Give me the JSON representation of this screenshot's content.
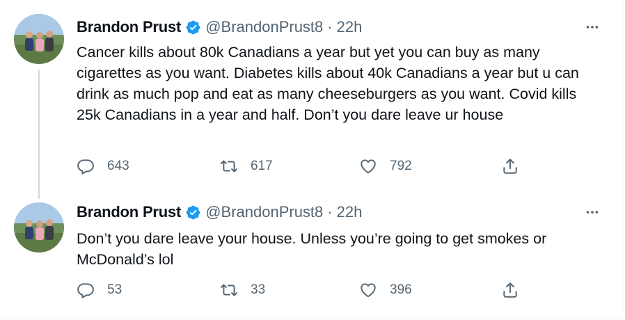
{
  "tweets": [
    {
      "name": "Brandon Prust",
      "handle": "@BrandonPrust8",
      "separator": "·",
      "time": "22h",
      "text": "Cancer kills about 80k Canadians a year but yet you can buy as many cigarettes as you want. Diabetes kills about 40k Canadians a year but u can drink as much pop and eat as many cheeseburgers as you want. Covid kills 25k Canadians in a year and half. Don’t you dare leave ur house",
      "replies": "643",
      "retweets": "617",
      "likes": "792"
    },
    {
      "name": "Brandon Prust",
      "handle": "@BrandonPrust8",
      "separator": "·",
      "time": "22h",
      "text": "Don’t you dare leave your house. Unless you’re going to get smokes or McDonald’s lol",
      "replies": "53",
      "retweets": "33",
      "likes": "396"
    }
  ],
  "icons": {
    "verified": "verified-badge-icon",
    "more": "more-options-icon",
    "reply": "reply-icon",
    "retweet": "retweet-icon",
    "like": "heart-icon",
    "share": "share-icon"
  },
  "colors": {
    "verified": "#1d9bf0",
    "muted": "#536471",
    "thread_line": "#cfd9de"
  }
}
